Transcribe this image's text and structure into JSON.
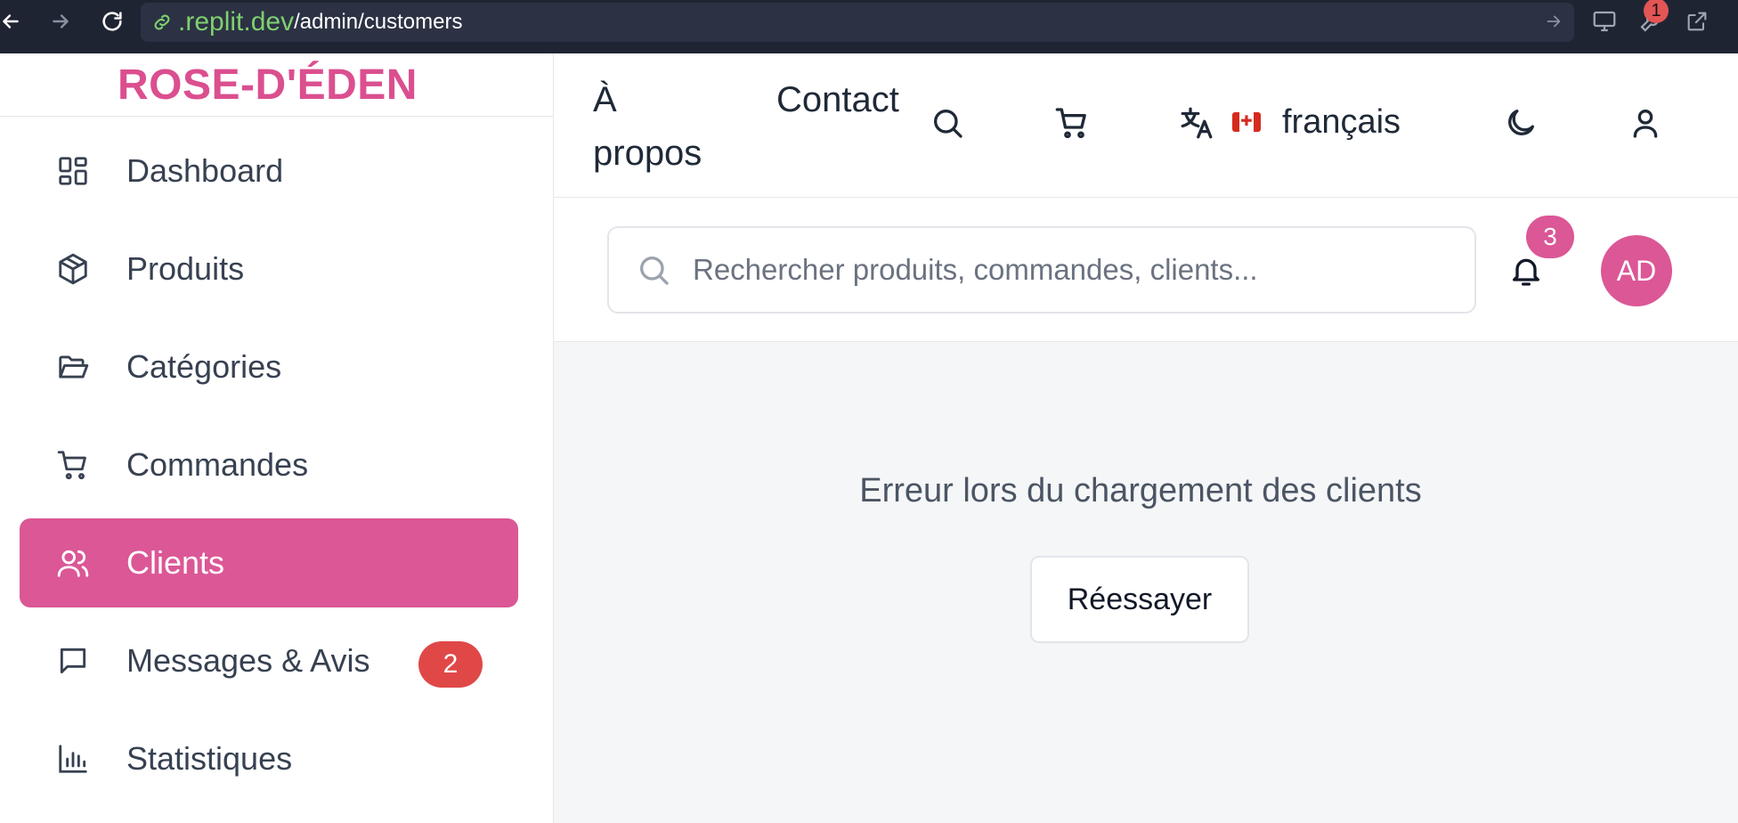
{
  "browser": {
    "url_host": ".replit.dev",
    "url_path": "/admin/customers",
    "tool_badge": "1"
  },
  "sidebar": {
    "brand": "ROSE-D'ÉDEN",
    "items": [
      {
        "label": "Dashboard",
        "icon": "dashboard-icon"
      },
      {
        "label": "Produits",
        "icon": "package-icon"
      },
      {
        "label": "Catégories",
        "icon": "folder-icon"
      },
      {
        "label": "Commandes",
        "icon": "cart-icon"
      },
      {
        "label": "Clients",
        "icon": "users-icon",
        "active": true
      },
      {
        "label": "Messages & Avis",
        "icon": "message-icon",
        "badge": "2"
      },
      {
        "label": "Statistiques",
        "icon": "bar-chart-icon"
      }
    ]
  },
  "topnav": {
    "about_line1": "À",
    "about_line2": "propos",
    "contact": "Contact",
    "language": "français",
    "flag": "canada-flag"
  },
  "search": {
    "placeholder": "Rechercher produits, commandes, clients..."
  },
  "notifications": {
    "count": "3"
  },
  "user": {
    "initials": "AD"
  },
  "main": {
    "error_message": "Erreur lors du chargement des clients",
    "retry_label": "Réessayer"
  },
  "colors": {
    "accent": "#db5796",
    "badge_red": "#e04848",
    "url_green": "#7fd06f"
  }
}
